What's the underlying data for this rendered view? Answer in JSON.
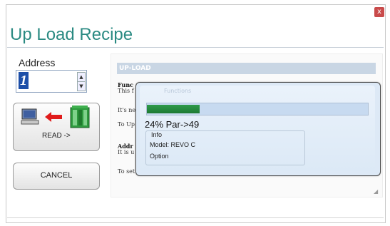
{
  "window": {
    "title": "Up Load Recipe",
    "close_glyph": "x"
  },
  "address": {
    "label": "Address",
    "value": "1",
    "spin_up_glyph": "▲",
    "spin_down_glyph": "▼"
  },
  "buttons": {
    "read_label": "READ ->",
    "cancel_label": "CANCEL"
  },
  "content": {
    "section_title": "UP-LOAD",
    "lines": [
      "Func",
      "This f",
      "It's ne",
      "To Up",
      "Addr",
      "It is u",
      "To set"
    ]
  },
  "progress": {
    "ghost_title": "Functions",
    "percent": 24,
    "text": "24% Par->49",
    "info_label": "Info",
    "model": "Model: REVO C",
    "option": "Option"
  },
  "colors": {
    "title": "#2a8a82",
    "section_head": "#c9d6e4",
    "progress_fill": "#1d7a33",
    "address_highlight": "#1d4fa8",
    "close_button": "#c94b4b"
  },
  "icons": [
    "computer-icon",
    "arrow-left-icon",
    "controller-cabinet-icon",
    "resize-grip-icon"
  ]
}
